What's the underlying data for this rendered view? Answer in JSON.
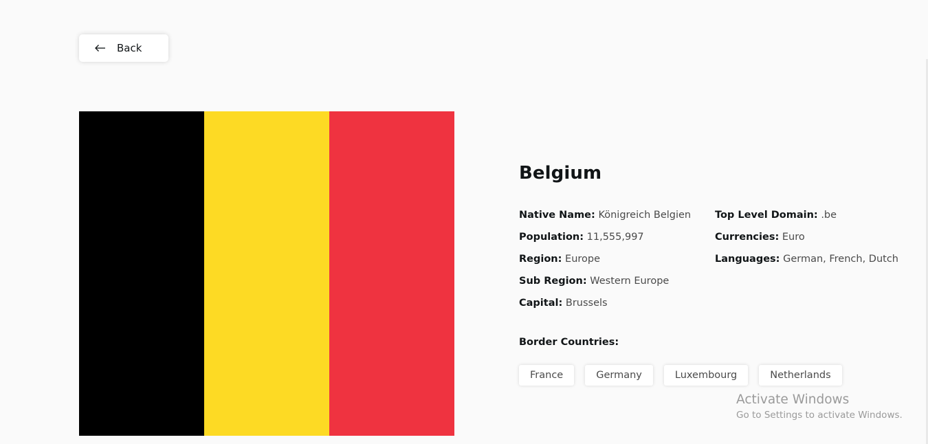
{
  "back": {
    "label": "Back",
    "icon": "arrow-left-icon"
  },
  "flag": {
    "colors": [
      "#000000",
      "#fdda24",
      "#ef3340"
    ]
  },
  "country": {
    "name": "Belgium",
    "left_column": [
      {
        "label": "Native Name:",
        "value": "Königreich Belgien"
      },
      {
        "label": "Population:",
        "value": "11,555,997"
      },
      {
        "label": "Region:",
        "value": "Europe"
      },
      {
        "label": "Sub Region:",
        "value": "Western Europe"
      },
      {
        "label": "Capital:",
        "value": "Brussels"
      }
    ],
    "right_column": [
      {
        "label": "Top Level Domain:",
        "value": ".be"
      },
      {
        "label": "Currencies:",
        "value": "Euro"
      },
      {
        "label": "Languages:",
        "value": "German, French, Dutch"
      }
    ],
    "border_label": "Border Countries:",
    "borders": [
      "France",
      "Germany",
      "Luxembourg",
      "Netherlands"
    ]
  },
  "watermark": {
    "title": "Activate Windows",
    "subtitle": "Go to Settings to activate Windows."
  }
}
